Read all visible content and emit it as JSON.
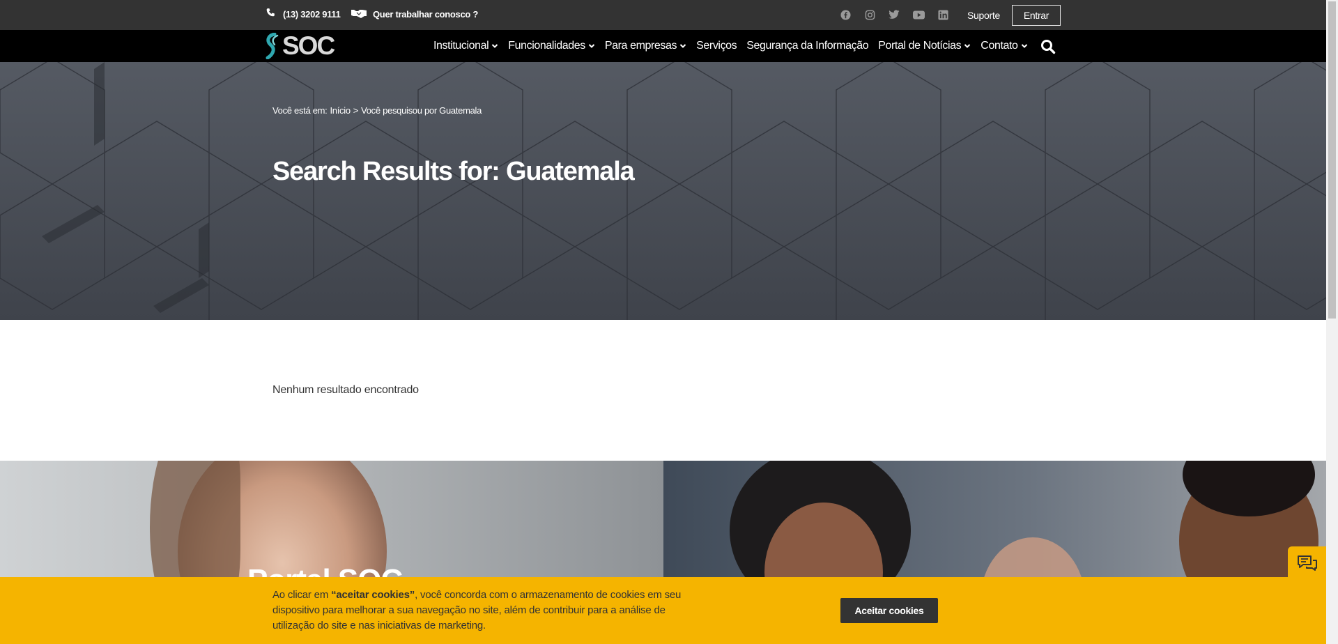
{
  "topbar": {
    "phone": "(13) 3202 9111",
    "work_with_us": "Quer trabalhar conosco ?",
    "support": "Suporte",
    "login": "Entrar",
    "socials": [
      "facebook-icon",
      "instagram-icon",
      "twitter-icon",
      "youtube-icon",
      "linkedin-icon"
    ]
  },
  "nav": {
    "logo": "SOC",
    "items": [
      {
        "label": "Institucional",
        "dropdown": true
      },
      {
        "label": "Funcionalidades",
        "dropdown": true
      },
      {
        "label": "Para empresas",
        "dropdown": true
      },
      {
        "label": "Serviços",
        "dropdown": false
      },
      {
        "label": "Segurança da Informação",
        "dropdown": false
      },
      {
        "label": "Portal de Notícias",
        "dropdown": true
      },
      {
        "label": "Contato",
        "dropdown": true
      }
    ]
  },
  "hero": {
    "breadcrumb_prefix": "Você está em:",
    "breadcrumb_home": "Início",
    "breadcrumb_sep": ">",
    "breadcrumb_current": "Você pesquisou por Guatemala",
    "title": "Search Results for: Guatemala"
  },
  "results": {
    "empty_message": "Nenhum resultado encontrado"
  },
  "promo": {
    "title": "Portal SOC"
  },
  "cookie": {
    "text_before": "Ao clicar em ",
    "text_bold": "“aceitar cookies”",
    "text_after": ", você concorda com o armazenamento de cookies em seu dispositivo para melhorar a sua navegação no site, além de contribuir para a análise de utilização do site e nas iniciativas de marketing.",
    "button": "Aceitar cookies"
  },
  "colors": {
    "accent": "#f5b400",
    "topbar": "#333333",
    "nav": "#000000",
    "hero": "#454a53"
  }
}
